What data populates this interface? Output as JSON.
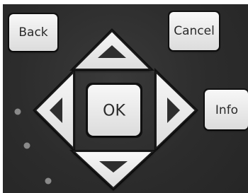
{
  "keypad": {
    "back_label": "Back",
    "cancel_label": "Cancel",
    "ok_label": "OK",
    "info_label": "Info",
    "up_icon": "triangle-up-icon",
    "down_icon": "triangle-down-icon",
    "left_icon": "triangle-left-icon",
    "right_icon": "triangle-right-icon",
    "key_color": "#ededed",
    "panel_color": "#2f2f2f",
    "led_color": "#8a8a8a"
  }
}
